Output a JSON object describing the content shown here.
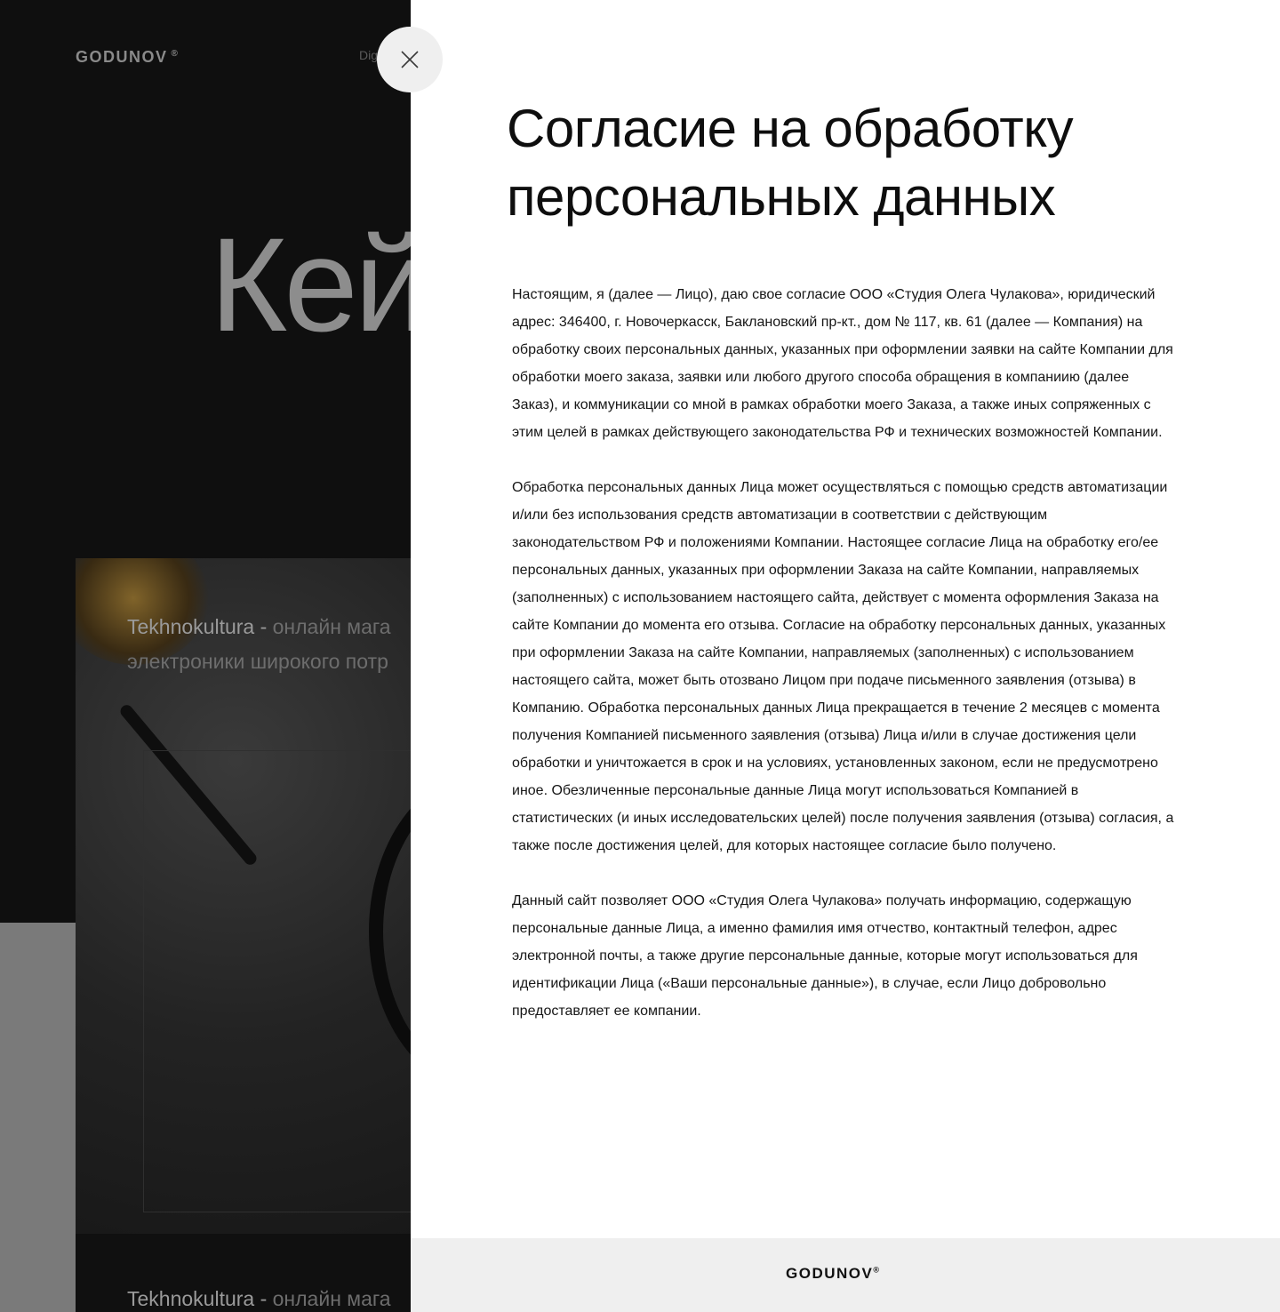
{
  "background": {
    "logo": "GODUNOV",
    "logo_mark": "®",
    "nav_fragment": "Dig",
    "hero_fragment": "Кей",
    "cards": [
      {
        "brand": "Tekhnokultura -",
        "line1": " онлайн мага",
        "line2": "электроники широкого потр"
      },
      {
        "brand": "Tekhnokultura -",
        "line1": " онлайн мага"
      }
    ]
  },
  "modal": {
    "title": "Согласие на обработку персональных данных",
    "paragraphs": [
      "Настоящим, я (далее — Лицо), даю свое согласие ООО «Студия Олега Чулакова», юридический адрес: 346400, г. Новочеркасск, Баклановский пр-кт., дом № 117, кв. 61 (далее — Компания) на обработку своих персональных данных, указанных при оформлении заявки на сайте Компании для обработки моего заказа, заявки или любого другого способа обращения в компаниию (далее Заказ), и коммуникации со мной в рамках обработки моего Заказа, а также иных сопряженных с этим целей в рамках действующего законодательства РФ и технических возможностей Компании.",
      "Обработка персональных данных Лица может осуществляться с помощью средств автоматизации и/или без использования средств автоматизации в соответствии с действующим законодательством РФ и положениями Компании. Настоящее согласие Лица на обработку его/ее персональных данных, указанных при оформлении Заказа на сайте Компании, направляемых (заполненных) с использованием настоящего сайта, действует с момента оформления Заказа на сайте Компании до момента его отзыва. Согласие на обработку персональных данных, указанных при оформлении Заказа на сайте Компании, направляемых (заполненных) с использованием настоящего сайта, может быть отозвано Лицом при подаче письменного заявления (отзыва) в Компанию. Обработка персональных данных Лица прекращается в течение 2 месяцев с момента получения Компанией письменного заявления (отзыва) Лица и/или в случае достижения цели обработки и уничтожается в срок и на условиях, установленных законом, если не предусмотрено иное. Обезличенные персональные данные Лица могут использоваться Компанией в статистических (и иных исследовательских целей) после получения заявления (отзыва) согласия, а также после достижения целей, для которых настоящее согласие было получено.",
      "Данный сайт позволяет ООО «Студия Олега Чулакова» получать информацию, содержащую персональные данные Лица, а именно фамилия имя отчество, контактный телефон, адрес электронной почты, а также другие персональные данные, которые могут использоваться для идентификации Лица («Ваши персональные данные»), в случае, если Лицо добровольно предоставляет ее компании."
    ],
    "close_icon": "close-icon",
    "footer_logo": "GODUNOV",
    "footer_logo_mark": "®"
  },
  "colors": {
    "modal_bg": "#ffffff",
    "footer_bg": "#efefef",
    "page_bg": "#0f0f0f",
    "text": "#161616"
  }
}
